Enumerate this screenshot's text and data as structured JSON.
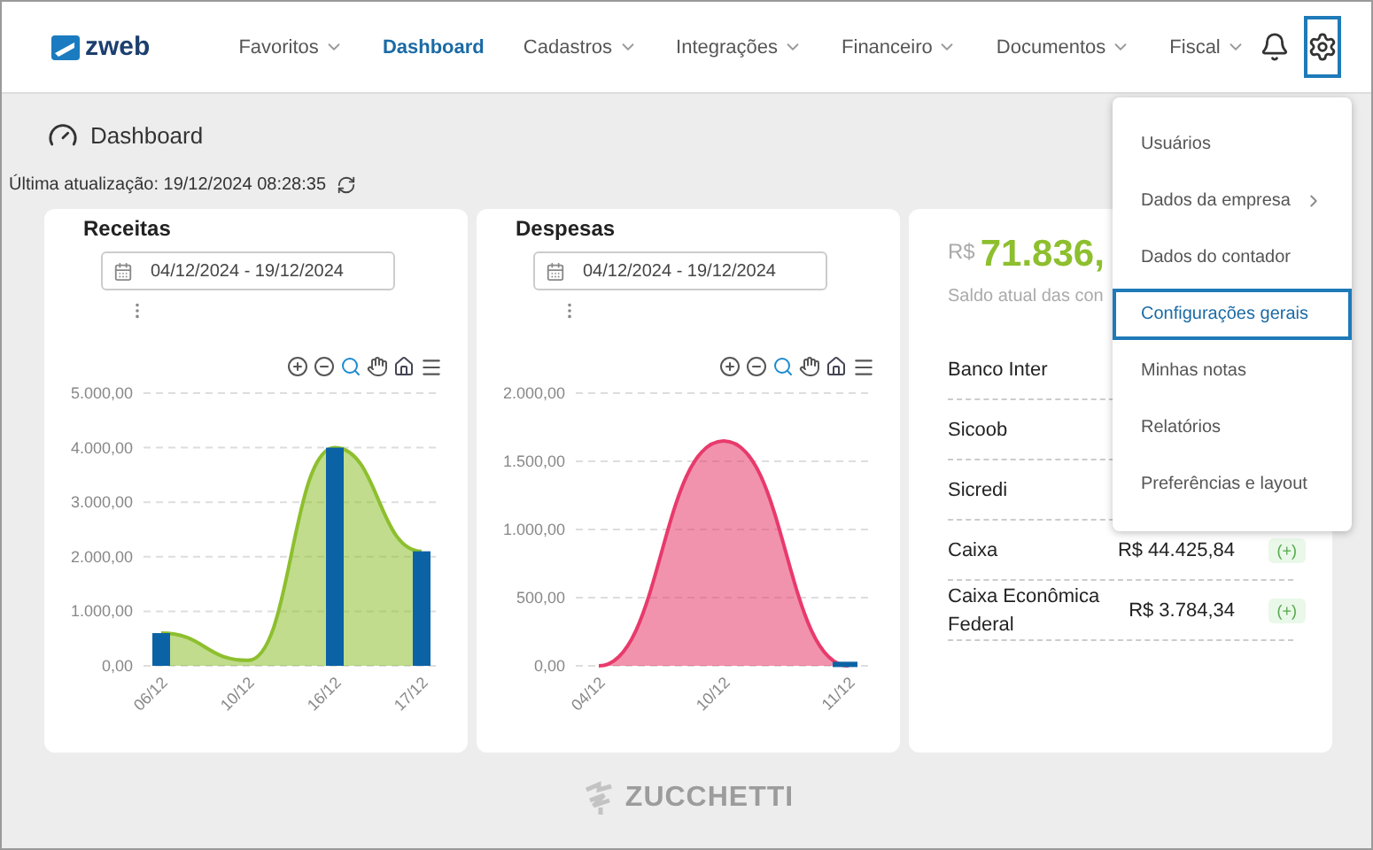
{
  "brand": {
    "name": "zweb"
  },
  "nav": [
    {
      "label": "Favoritos",
      "selected": false,
      "dropdown": true
    },
    {
      "label": "Dashboard",
      "selected": true,
      "dropdown": false
    },
    {
      "label": "Cadastros",
      "selected": false,
      "dropdown": true
    },
    {
      "label": "Integrações",
      "selected": false,
      "dropdown": true
    },
    {
      "label": "Financeiro",
      "selected": false,
      "dropdown": true
    },
    {
      "label": "Documentos",
      "selected": false,
      "dropdown": true
    },
    {
      "label": "Fiscal",
      "selected": false,
      "dropdown": true
    }
  ],
  "settings_button": {
    "selected": true
  },
  "page": {
    "title": "Dashboard",
    "updated": "Última atualização: 19/12/2024 08:28:35"
  },
  "charts": [
    {
      "title": "Receitas",
      "date_range": "04/12/2024 - 19/12/2024",
      "chart_data": {
        "type": "bar",
        "grid": true,
        "categories": [
          "06/12",
          "10/12",
          "16/12",
          "17/12"
        ],
        "series": [
          {
            "color": "#0b63a6",
            "values": [
              600,
              0,
              4000,
              2100
            ]
          },
          {
            "type": "area",
            "color": "#8dbf2e",
            "values": [
              600,
              100,
              4000,
              2100
            ]
          }
        ],
        "ylim": [
          0,
          5000
        ],
        "yticks": [
          {
            "value": 0,
            "label": "0,00"
          },
          {
            "value": 1000,
            "label": "1.000,00"
          },
          {
            "value": 2000,
            "label": "2.000,00"
          },
          {
            "value": 3000,
            "label": "3.000,00"
          },
          {
            "value": 4000,
            "label": "4.000,00"
          },
          {
            "value": 5000,
            "label": "5.000,00"
          }
        ]
      }
    },
    {
      "title": "Despesas",
      "date_range": "04/12/2024 - 19/12/2024",
      "chart_data": {
        "type": "bar",
        "grid": true,
        "categories": [
          "04/12",
          "10/12",
          "11/12"
        ],
        "series": [
          {
            "color": "#0b63a6",
            "values": [
              0,
              0,
              30
            ]
          },
          {
            "type": "area",
            "color": "#e83a6b",
            "values": [
              0,
              1650,
              0
            ]
          }
        ],
        "ylim": [
          0,
          2000
        ],
        "yticks": [
          {
            "value": 0,
            "label": "0,00"
          },
          {
            "value": 500,
            "label": "500,00"
          },
          {
            "value": 1000,
            "label": "1.000,00"
          },
          {
            "value": 1500,
            "label": "1.500,00"
          },
          {
            "value": 2000,
            "label": "2.000,00"
          }
        ]
      }
    }
  ],
  "balance": {
    "currency": "R$",
    "amount": "71.836,",
    "caption": "Saldo atual das con",
    "accounts": [
      {
        "name": "Banco Inter"
      },
      {
        "name": "Sicoob"
      },
      {
        "name": "Sicredi"
      },
      {
        "name": "Caixa",
        "value": "R$ 44.425,84",
        "action": "(+)"
      },
      {
        "name": "Caixa Econômica Federal",
        "value": "R$ 3.784,34",
        "action": "(+)"
      }
    ]
  },
  "settings_menu": [
    {
      "label": "Usuários",
      "selected": false,
      "submenu": false
    },
    {
      "label": "Dados da empresa",
      "selected": false,
      "submenu": true
    },
    {
      "label": "Dados do contador",
      "selected": false,
      "submenu": false
    },
    {
      "label": "Configurações gerais",
      "selected": true,
      "submenu": false
    },
    {
      "label": "Minhas notas",
      "selected": false,
      "submenu": false
    },
    {
      "label": "Relatórios",
      "selected": false,
      "submenu": false
    },
    {
      "label": "Preferências e layout",
      "selected": false,
      "submenu": false
    }
  ],
  "footer": {
    "brand": "ZUCCHETTI"
  }
}
